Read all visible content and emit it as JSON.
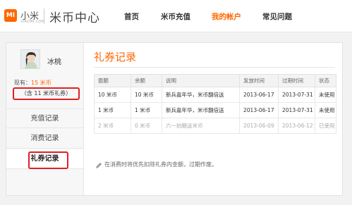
{
  "header": {
    "logo_text": "MI",
    "brand": "小米",
    "brand_sub": "XIAOMI.COM",
    "site_title": "米币中心",
    "nav": [
      {
        "label": "首页",
        "active": false
      },
      {
        "label": "米币充值",
        "active": false
      },
      {
        "label": "我的帐户",
        "active": true
      },
      {
        "label": "常见问题",
        "active": false
      }
    ],
    "accent_color": "#ff6700"
  },
  "sidebar": {
    "username": "冰桃",
    "balance_prefix": "现有：",
    "balance_amount": "15 米币",
    "coupon_note": "（含 11 米币礼券）",
    "items": [
      {
        "label": "充值记录"
      },
      {
        "label": "消费记录"
      },
      {
        "label": "礼券记录",
        "selected": true
      }
    ]
  },
  "content": {
    "title": "礼券记录",
    "table": {
      "headers": [
        "面额",
        "余额",
        "说明",
        "发放时间",
        "过期时间",
        "状态"
      ],
      "rows": [
        [
          "10 米币",
          "10 米币",
          "新兵嘉年华，米币翻倍送",
          "2013-06-17",
          "2013-07-31",
          "未使用"
        ],
        [
          "1 米币",
          "1 米币",
          "新兵嘉年华，米币翻倍送",
          "2013-06-17",
          "2013-07-31",
          "未使用"
        ],
        [
          "2 米币",
          "0 米币",
          "六一拍糖送米币",
          "2013-06-09",
          "2013-06-12",
          "已使用"
        ]
      ]
    },
    "note": "在消费时将优先扣除礼券内金额，过期作废。"
  }
}
